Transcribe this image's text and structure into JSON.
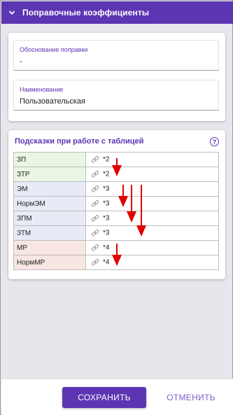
{
  "header": {
    "title": "Поправочные коэффициенты",
    "icon": "chevron-down-icon"
  },
  "fields": [
    {
      "label": "Обоснование поправки",
      "value": "-"
    },
    {
      "label": "Наименование",
      "value": "Пользовательская"
    }
  ],
  "hints": {
    "title": "Подсказки при работе с таблицей",
    "help_icon_text": "?",
    "rows": [
      {
        "name": "ЗП",
        "value": "*2",
        "group": "green"
      },
      {
        "name": "ЗТР",
        "value": "*2",
        "group": "green"
      },
      {
        "name": "ЭМ",
        "value": "*3",
        "group": "blue"
      },
      {
        "name": "НормЭМ",
        "value": "*3",
        "group": "blue"
      },
      {
        "name": "ЗПМ",
        "value": "*3",
        "group": "blue"
      },
      {
        "name": "ЗТМ",
        "value": "*3",
        "group": "blue"
      },
      {
        "name": "МР",
        "value": "*4",
        "group": "pink"
      },
      {
        "name": "НормМР",
        "value": "*4",
        "group": "pink"
      }
    ]
  },
  "footer": {
    "save_label": "СОХРАНИТЬ",
    "cancel_label": "ОТМЕНИТЬ"
  },
  "colors": {
    "accent": "#5c35b3",
    "arrow": "#e00000",
    "green_cell": "#eaf5e3",
    "blue_cell": "#e6ebf6",
    "pink_cell": "#f7e6e2"
  }
}
